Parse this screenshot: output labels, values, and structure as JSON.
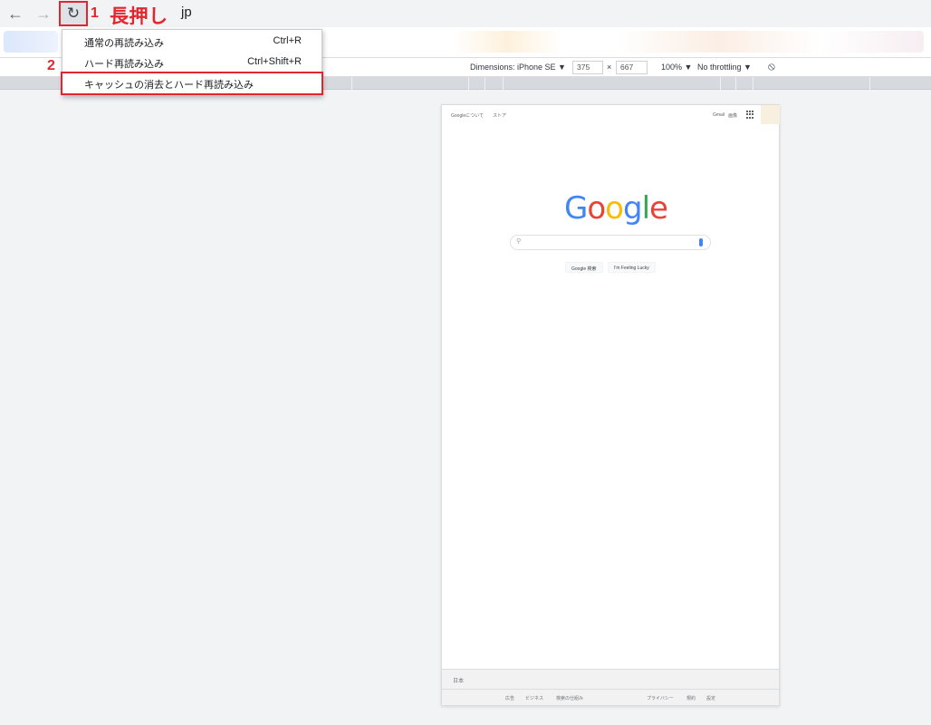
{
  "browser": {
    "back_icon": "←",
    "forward_icon": "→",
    "reload_icon": "↻",
    "url_visible": "jp"
  },
  "annotations": {
    "step1_number": "1",
    "step1_text": "長押し",
    "step2_number": "2",
    "color": "#e3262d"
  },
  "context_menu": {
    "items": [
      {
        "label": "通常の再読み込み",
        "shortcut": "Ctrl+R"
      },
      {
        "label": "ハード再読み込み",
        "shortcut": "Ctrl+Shift+R"
      },
      {
        "label": "キャッシュの消去とハード再読み込み",
        "shortcut": ""
      }
    ]
  },
  "device_toolbar": {
    "dimensions_label": "Dimensions: iPhone SE ▼",
    "width": "375",
    "times": "×",
    "height": "667",
    "zoom": "100% ▼",
    "throttling": "No throttling ▼",
    "rotate_icon": "⦸"
  },
  "google_page": {
    "top_left": [
      "Googleについて",
      "ストア"
    ],
    "top_right": [
      "Gmail",
      "画像"
    ],
    "logo_letters": [
      {
        "ch": "G",
        "color": "#4285f4"
      },
      {
        "ch": "o",
        "color": "#ea4335"
      },
      {
        "ch": "o",
        "color": "#fbbc05"
      },
      {
        "ch": "g",
        "color": "#4285f4"
      },
      {
        "ch": "l",
        "color": "#34a853"
      },
      {
        "ch": "e",
        "color": "#ea4335"
      }
    ],
    "search_button": "Google 検索",
    "lucky_button": "I'm Feeling Lucky",
    "footer_country": "日本",
    "footer_links_left": [
      "広告",
      "ビジネス",
      "検索の仕組み"
    ],
    "footer_links_right": [
      "プライバシー",
      "規約",
      "設定"
    ]
  }
}
